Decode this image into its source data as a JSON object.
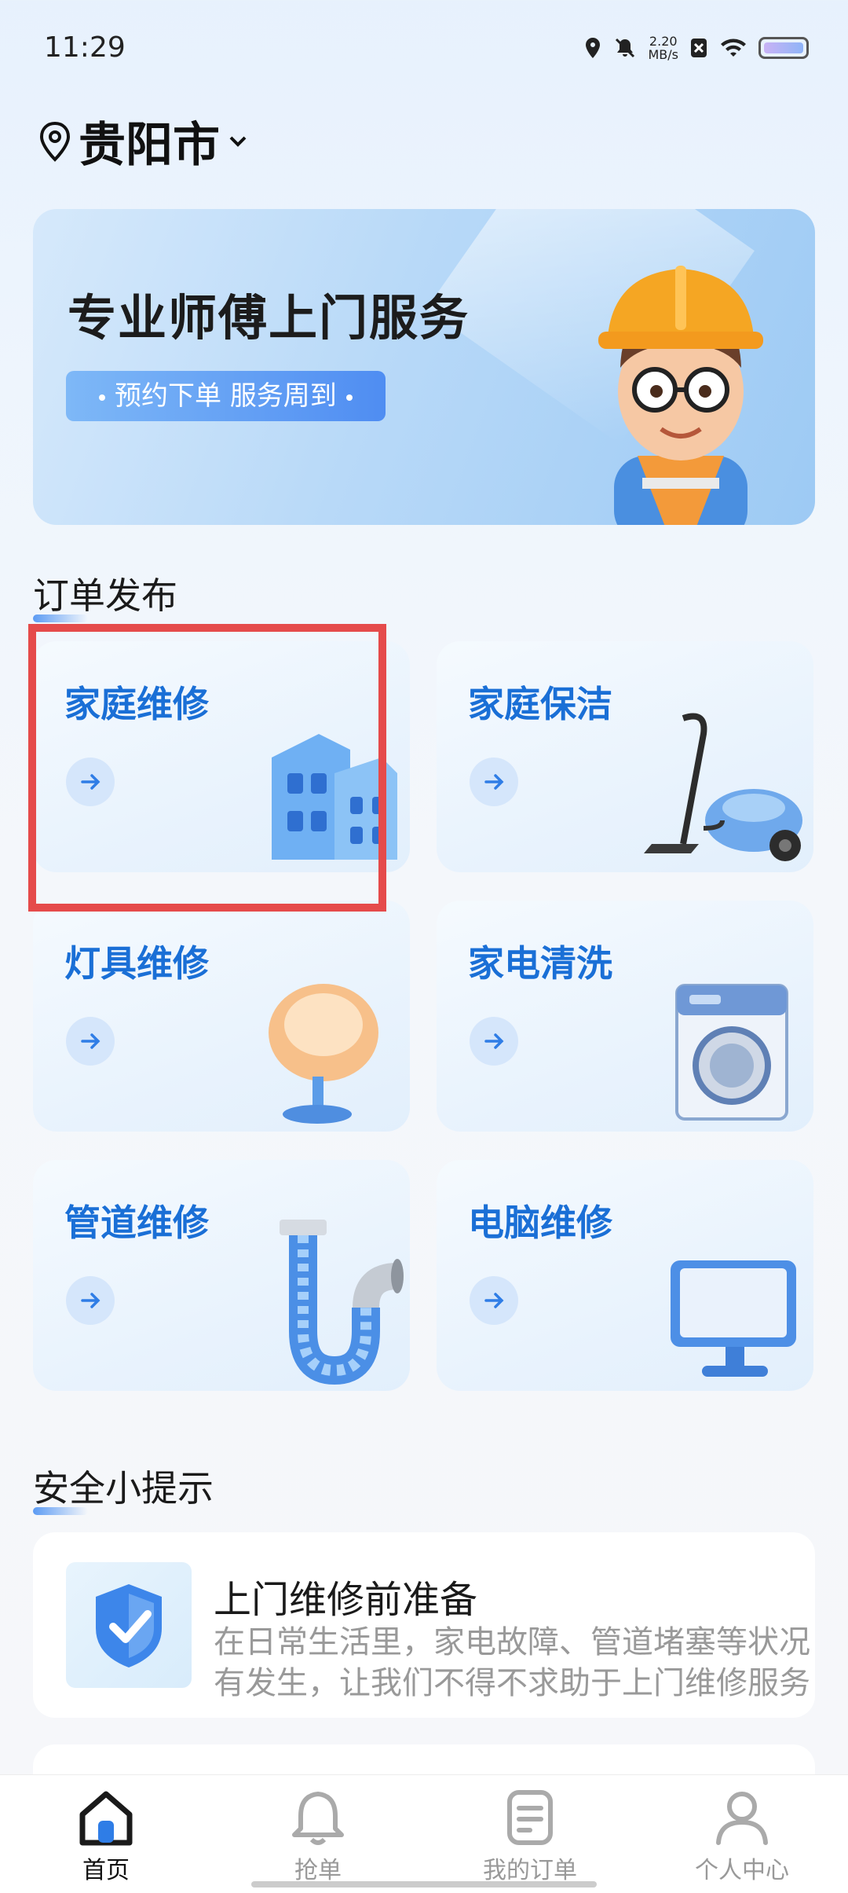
{
  "status_bar": {
    "time": "11:29",
    "net_speed_value": "2.20",
    "net_speed_unit": "MB/s"
  },
  "location": {
    "city": "贵阳市",
    "icon": "location-pin-icon"
  },
  "banner": {
    "title": "专业师傅上门服务",
    "tag_left": "预约下单",
    "tag_right": "服务周到"
  },
  "orders": {
    "section_title": "订单发布",
    "items": [
      {
        "label": "家庭维修",
        "icon": "building-icon"
      },
      {
        "label": "家庭保洁",
        "icon": "vacuum-icon"
      },
      {
        "label": "灯具维修",
        "icon": "lamp-icon"
      },
      {
        "label": "家电清洗",
        "icon": "washing-machine-icon"
      },
      {
        "label": "管道维修",
        "icon": "pipe-icon"
      },
      {
        "label": "电脑维修",
        "icon": "monitor-icon"
      }
    ]
  },
  "tips": {
    "section_title": "安全小提示",
    "items": [
      {
        "title": "上门维修前准备",
        "line1": "在日常生活里，家电故障、管道堵塞等状况",
        "line2": "有发生，让我们不得不求助于上门维修服务"
      }
    ]
  },
  "nav": {
    "items": [
      {
        "label": "首页",
        "icon": "home-icon",
        "active": true
      },
      {
        "label": "抢单",
        "icon": "bell-icon"
      },
      {
        "label": "我的订单",
        "icon": "order-list-icon"
      },
      {
        "label": "个人中心",
        "icon": "user-icon"
      }
    ]
  },
  "colors": {
    "accent": "#1a6fd6",
    "highlight": "#e54b4b"
  }
}
